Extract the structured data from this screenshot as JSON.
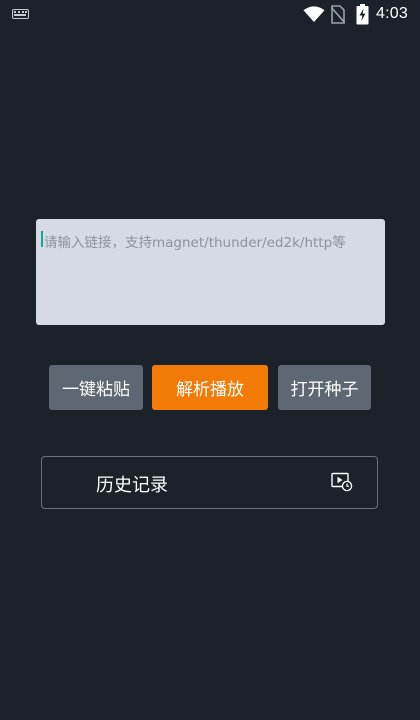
{
  "status_bar": {
    "time": "4:03",
    "icons": [
      "keyboard-icon",
      "wifi-icon",
      "no-sim-icon",
      "battery-charging-icon"
    ]
  },
  "link_input": {
    "placeholder": "请输入链接，支持magnet/thunder/ed2k/http等",
    "value": ""
  },
  "actions": {
    "paste_label": "一键粘贴",
    "parse_label": "解析播放",
    "torrent_label": "打开种子"
  },
  "history": {
    "label": "历史记录",
    "icon": "video-history-icon"
  },
  "colors": {
    "background": "#1b222a",
    "input_background": "#d6dae2",
    "primary_button": "#f27a07",
    "secondary_button": "#5d6874",
    "caret": "#1aa39a"
  }
}
